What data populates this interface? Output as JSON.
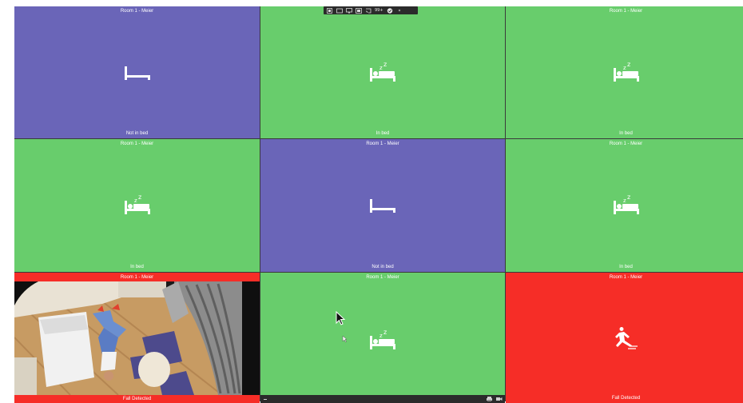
{
  "tiles": [
    {
      "title": "Room 1 - Meier",
      "status": "Not in bed",
      "state": "not-in-bed",
      "color": "#6a65b8"
    },
    {
      "title": "Room 1 - Meier",
      "status": "In bed",
      "state": "in-bed",
      "color": "#68cd6c"
    },
    {
      "title": "Room 1 - Meier",
      "status": "In bed",
      "state": "in-bed",
      "color": "#68cd6c"
    },
    {
      "title": "Room 1 - Meier",
      "status": "In bed",
      "state": "in-bed",
      "color": "#68cd6c"
    },
    {
      "title": "Room 1 - Meier",
      "status": "Not in bed",
      "state": "not-in-bed",
      "color": "#6a65b8"
    },
    {
      "title": "Room 1 - Meier",
      "status": "In bed",
      "state": "in-bed",
      "color": "#68cd6c"
    },
    {
      "title": "Room 1 - Meier",
      "status": "Fall Detected",
      "state": "camera-fall",
      "color": "#f62d27"
    },
    {
      "title": "Room 1 - Meier",
      "status": "",
      "state": "in-bed",
      "color": "#68cd6c"
    },
    {
      "title": "Room 1 - Meier",
      "status": "Fall Detected",
      "state": "fall",
      "color": "#f62d27"
    }
  ],
  "toolbar": {
    "items": [
      "camera-switch-icon",
      "frame-icon",
      "monitor-icon",
      "display-icon",
      "cast-icon"
    ],
    "badge": "99+",
    "status_icon": "check-icon",
    "close_icon": "close-icon"
  },
  "control_bar": {
    "icons": [
      "menu-icon",
      "printer-icon",
      "video-camera-icon"
    ]
  }
}
